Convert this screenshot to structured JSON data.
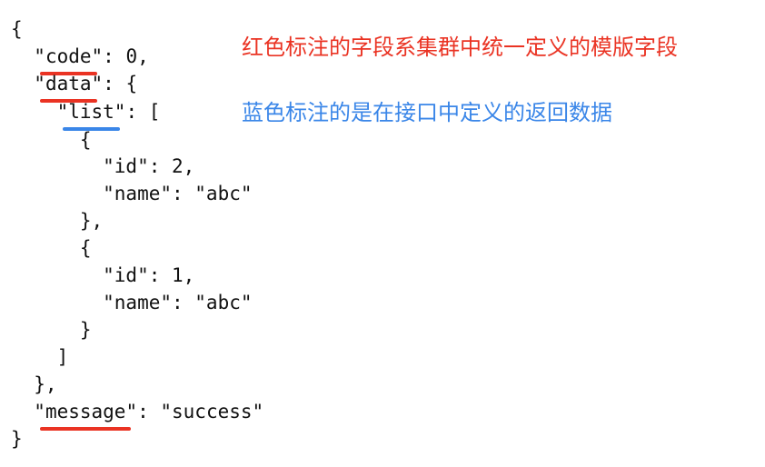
{
  "colors": {
    "red": "#ea3323",
    "blue": "#3a86e8",
    "text": "#111111"
  },
  "code_lines": [
    {
      "before": "{"
    },
    {
      "before": "  \"",
      "key": "code",
      "after": "\": 0,",
      "mark": "red"
    },
    {
      "before": "  \"",
      "key": "data",
      "after": "\": {",
      "mark": "red"
    },
    {
      "before": "    \"",
      "key": "list",
      "after": "\": [",
      "mark": "blue"
    },
    {
      "before": "      {"
    },
    {
      "before": "        \"id\": 2,"
    },
    {
      "before": "        \"name\": \"abc\""
    },
    {
      "before": "      },"
    },
    {
      "before": "      {"
    },
    {
      "before": "        \"id\": 1,"
    },
    {
      "before": "        \"name\": \"abc\""
    },
    {
      "before": "      }"
    },
    {
      "before": "    ]"
    },
    {
      "before": "  },"
    },
    {
      "before": "  \"",
      "key": "message",
      "after": "\": \"success\"",
      "mark": "red"
    },
    {
      "before": "}"
    }
  ],
  "annotations": {
    "red_note": "红色标注的字段系集群中统一定义的模版字段",
    "blue_note": "蓝色标注的是在接口中定义的返回数据"
  }
}
